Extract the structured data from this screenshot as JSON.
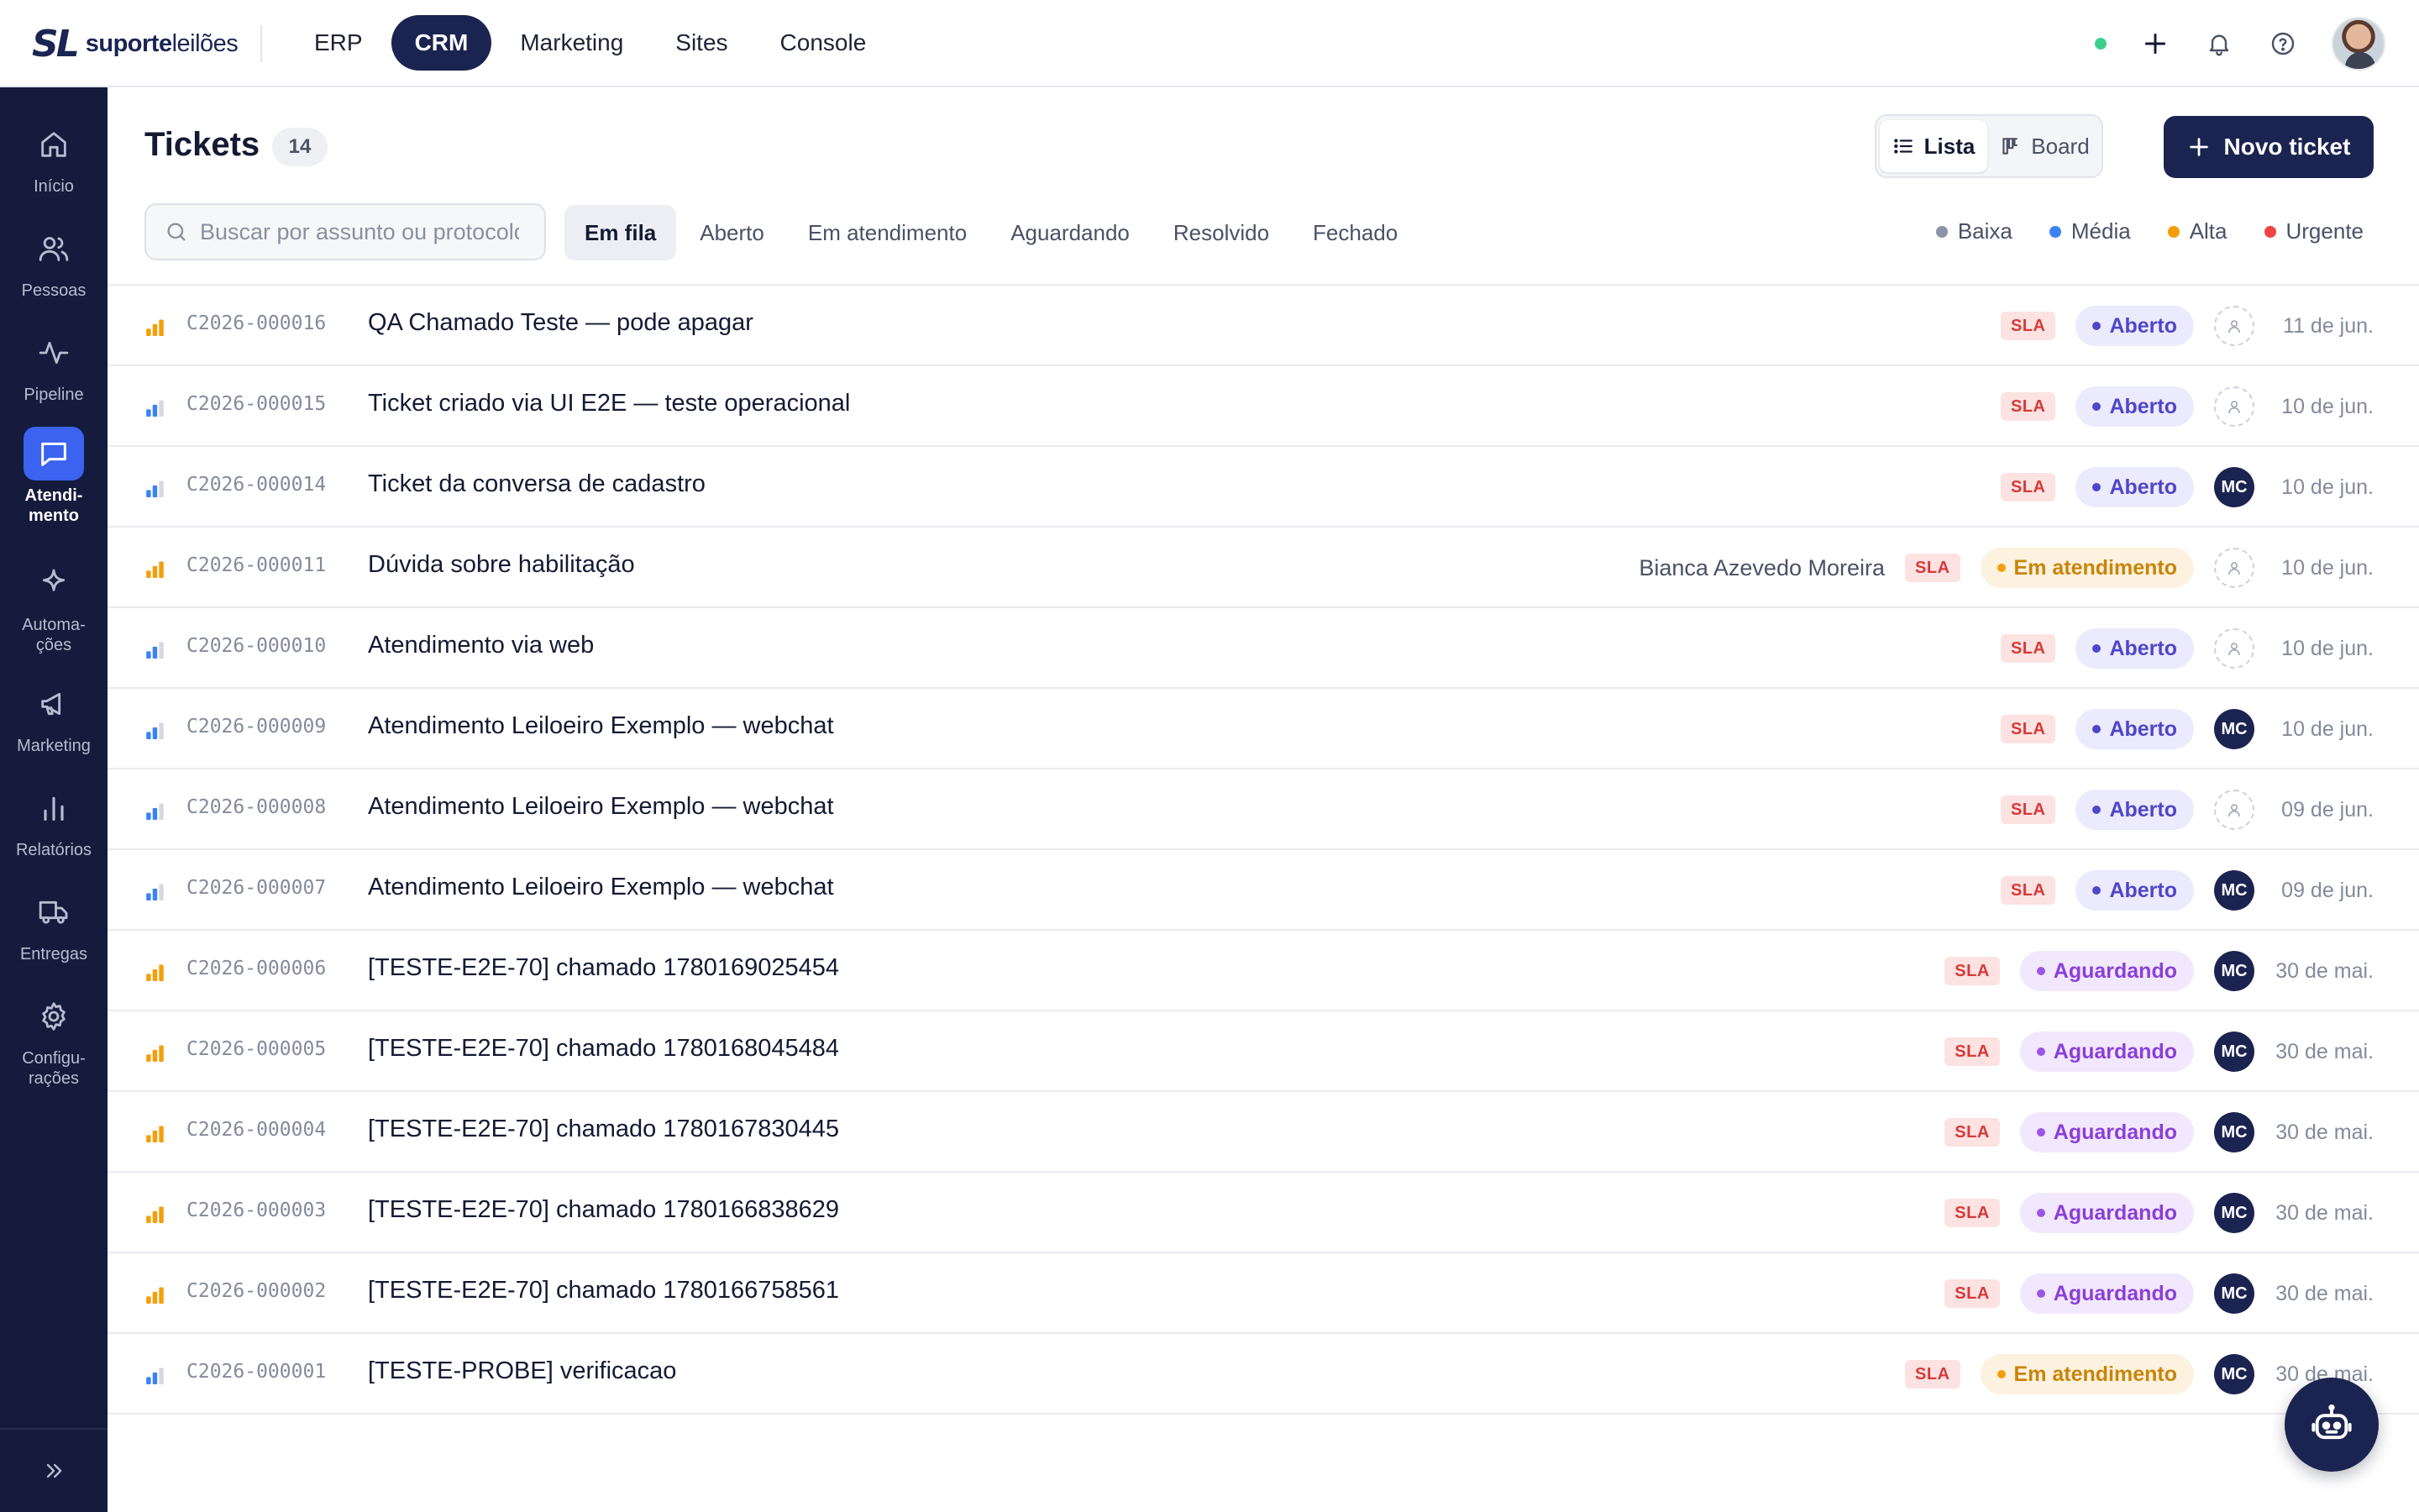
{
  "brand": {
    "mark": "SL",
    "name_bold": "suporte",
    "name_light": "leilões"
  },
  "topnav": [
    {
      "label": "ERP",
      "active": false
    },
    {
      "label": "CRM",
      "active": true
    },
    {
      "label": "Marketing",
      "active": false
    },
    {
      "label": "Sites",
      "active": false
    },
    {
      "label": "Console",
      "active": false
    }
  ],
  "sidebar": {
    "items": [
      {
        "label": "Início",
        "icon": "home-icon"
      },
      {
        "label": "Pessoas",
        "icon": "users-icon"
      },
      {
        "label": "Pipeline",
        "icon": "pulse-icon"
      },
      {
        "label": "Atendi-\nmento",
        "icon": "chat-icon",
        "active": true
      },
      {
        "label": "Automa-\nções",
        "icon": "sparkle-icon"
      },
      {
        "label": "Marketing",
        "icon": "megaphone-icon"
      },
      {
        "label": "Relatórios",
        "icon": "bar-chart-icon"
      },
      {
        "label": "Entregas",
        "icon": "truck-icon"
      },
      {
        "label": "Configu-\nrações",
        "icon": "gear-icon"
      }
    ]
  },
  "header": {
    "title": "Tickets",
    "count": "14",
    "view_list": "Lista",
    "view_board": "Board",
    "new_ticket": "Novo ticket"
  },
  "search": {
    "placeholder": "Buscar por assunto ou protocolo"
  },
  "filters": [
    "Em fila",
    "Aberto",
    "Em atendimento",
    "Aguardando",
    "Resolvido",
    "Fechado"
  ],
  "legend": [
    {
      "label": "Baixa",
      "color": "#8b93a7"
    },
    {
      "label": "Média",
      "color": "#3b82f6"
    },
    {
      "label": "Alta",
      "color": "#f59e0b"
    },
    {
      "label": "Urgente",
      "color": "#ef4444"
    }
  ],
  "sla_label": "SLA",
  "tickets": [
    {
      "protocol": "C2026-000016",
      "subject": "QA Chamado Teste — pode apagar",
      "priority": "alta",
      "requester": "",
      "status": "Aberto",
      "status_kind": "aberto",
      "assignee": "",
      "date": "11 de jun."
    },
    {
      "protocol": "C2026-000015",
      "subject": "Ticket criado via UI E2E — teste operacional",
      "priority": "media",
      "requester": "",
      "status": "Aberto",
      "status_kind": "aberto",
      "assignee": "",
      "date": "10 de jun."
    },
    {
      "protocol": "C2026-000014",
      "subject": "Ticket da conversa de cadastro",
      "priority": "media",
      "requester": "",
      "status": "Aberto",
      "status_kind": "aberto",
      "assignee": "MC",
      "date": "10 de jun."
    },
    {
      "protocol": "C2026-000011",
      "subject": "Dúvida sobre habilitação",
      "priority": "alta",
      "requester": "Bianca Azevedo Moreira",
      "status": "Em atendimento",
      "status_kind": "atendimento",
      "assignee": "",
      "date": "10 de jun."
    },
    {
      "protocol": "C2026-000010",
      "subject": "Atendimento via web",
      "priority": "media",
      "requester": "",
      "status": "Aberto",
      "status_kind": "aberto",
      "assignee": "",
      "date": "10 de jun."
    },
    {
      "protocol": "C2026-000009",
      "subject": "Atendimento Leiloeiro Exemplo — webchat",
      "priority": "media",
      "requester": "",
      "status": "Aberto",
      "status_kind": "aberto",
      "assignee": "MC",
      "date": "10 de jun."
    },
    {
      "protocol": "C2026-000008",
      "subject": "Atendimento Leiloeiro Exemplo — webchat",
      "priority": "media",
      "requester": "",
      "status": "Aberto",
      "status_kind": "aberto",
      "assignee": "",
      "date": "09 de jun."
    },
    {
      "protocol": "C2026-000007",
      "subject": "Atendimento Leiloeiro Exemplo — webchat",
      "priority": "media",
      "requester": "",
      "status": "Aberto",
      "status_kind": "aberto",
      "assignee": "MC",
      "date": "09 de jun."
    },
    {
      "protocol": "C2026-000006",
      "subject": "[TESTE-E2E-70] chamado 1780169025454",
      "priority": "alta",
      "requester": "",
      "status": "Aguardando",
      "status_kind": "aguardando",
      "assignee": "MC",
      "date": "30 de mai."
    },
    {
      "protocol": "C2026-000005",
      "subject": "[TESTE-E2E-70] chamado 1780168045484",
      "priority": "alta",
      "requester": "",
      "status": "Aguardando",
      "status_kind": "aguardando",
      "assignee": "MC",
      "date": "30 de mai."
    },
    {
      "protocol": "C2026-000004",
      "subject": "[TESTE-E2E-70] chamado 1780167830445",
      "priority": "alta",
      "requester": "",
      "status": "Aguardando",
      "status_kind": "aguardando",
      "assignee": "MC",
      "date": "30 de mai."
    },
    {
      "protocol": "C2026-000003",
      "subject": "[TESTE-E2E-70] chamado 1780166838629",
      "priority": "alta",
      "requester": "",
      "status": "Aguardando",
      "status_kind": "aguardando",
      "assignee": "MC",
      "date": "30 de mai."
    },
    {
      "protocol": "C2026-000002",
      "subject": "[TESTE-E2E-70] chamado 1780166758561",
      "priority": "alta",
      "requester": "",
      "status": "Aguardando",
      "status_kind": "aguardando",
      "assignee": "MC",
      "date": "30 de mai."
    },
    {
      "protocol": "C2026-000001",
      "subject": "[TESTE-PROBE] verificacao",
      "priority": "media",
      "requester": "",
      "status": "Em atendimento",
      "status_kind": "atendimento",
      "assignee": "MC",
      "date": "30 de mai."
    }
  ],
  "colors": {
    "navy": "#1b2450",
    "sidebar": "#141b3c",
    "accent": "#3b63f0",
    "priority_alta": "#f59e0b",
    "priority_media": "#3b82f6"
  }
}
